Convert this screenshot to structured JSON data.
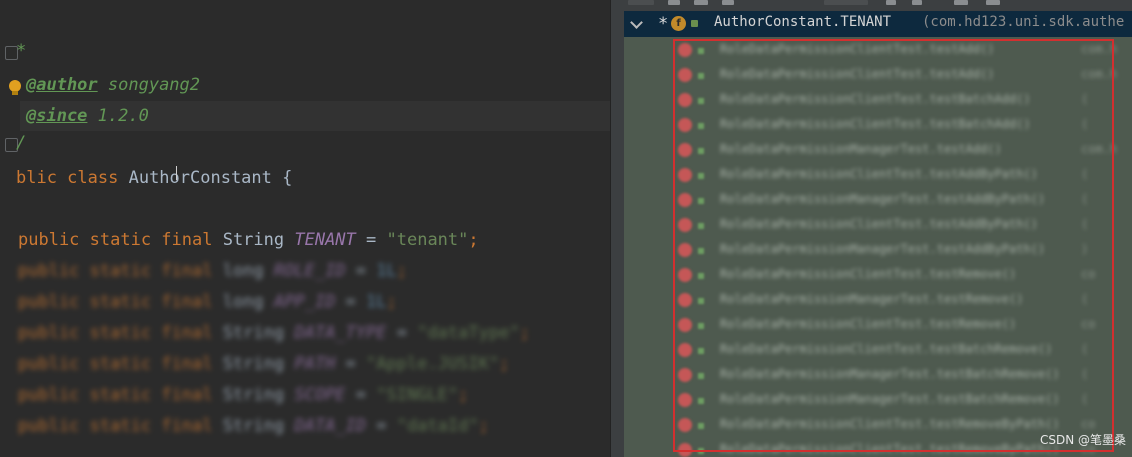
{
  "editor": {
    "doc_star": "*",
    "author_tag": "@author",
    "author_value": " songyang2",
    "since_tag": "@since",
    "since_value": " 1.2.0",
    "doc_end": "/",
    "class_kw": "blic class ",
    "class_name": "AuthorConstant",
    "class_brace": " {",
    "field_mods": "public static final ",
    "field_type": "String ",
    "field_name": "TENANT",
    "field_eq": " = ",
    "field_value": "\"tenant\"",
    "field_semi": ";"
  },
  "blurred_fields": [
    {
      "mods": "public static final ",
      "type": "long ",
      "name": "ROLE_ID",
      "value": "1L",
      "value_kind": "num"
    },
    {
      "mods": "public static final ",
      "type": "long ",
      "name": "APP_ID",
      "value": "1L",
      "value_kind": "num"
    },
    {
      "mods": "public static final ",
      "type": "String ",
      "name": "DATA_TYPE",
      "value": "\"dataType\"",
      "value_kind": "str"
    },
    {
      "mods": "public static final ",
      "type": "String ",
      "name": "PATH",
      "value": "\"Apple.JUSIK\"",
      "value_kind": "str"
    },
    {
      "mods": "public static final ",
      "type": "String ",
      "name": "SCOPE",
      "value": "\"SINGLE\"",
      "value_kind": "str"
    },
    {
      "mods": "public static final ",
      "type": "String ",
      "name": "DATA_ID",
      "value": "\"dataId\"",
      "value_kind": "str"
    }
  ],
  "usages_panel": {
    "star": "*",
    "field_badge": "f",
    "selected_title": "AuthorConstant.TENANT",
    "selected_package": "(com.hd123.uni.sdk.authe",
    "rows": [
      {
        "text": "RoleDataPermissionClientTest.testAdd()",
        "tail": "com.h"
      },
      {
        "text": "RoleDataPermissionClientTest.testAdd()",
        "tail": "com.h"
      },
      {
        "text": "RoleDataPermissionClientTest.testBatchAdd()",
        "tail": "("
      },
      {
        "text": "RoleDataPermissionClientTest.testBatchAdd()",
        "tail": "("
      },
      {
        "text": "RoleDataPermissionManagerTest.testAdd()",
        "tail": "com.h"
      },
      {
        "text": "RoleDataPermissionClientTest.testAddByPath()",
        "tail": "("
      },
      {
        "text": "RoleDataPermissionManagerTest.testAddByPath()",
        "tail": "("
      },
      {
        "text": "RoleDataPermissionClientTest.testAddByPath()",
        "tail": "("
      },
      {
        "text": "RoleDataPermissionManagerTest.testAddByPath()",
        "tail": ")"
      },
      {
        "text": "RoleDataPermissionClientTest.testRemove()",
        "tail": "co"
      },
      {
        "text": "RoleDataPermissionManagerTest.testRemove()",
        "tail": "("
      },
      {
        "text": "RoleDataPermissionClientTest.testRemove()",
        "tail": "co"
      },
      {
        "text": "RoleDataPermissionClientTest.testBatchRemove()",
        "tail": "("
      },
      {
        "text": "RoleDataPermissionManagerTest.testBatchRemove()",
        "tail": "("
      },
      {
        "text": "RoleDataPermissionManagerTest.testBatchRemove()",
        "tail": "("
      },
      {
        "text": "RoleDataPermissionClientTest.testRemoveByPath()",
        "tail": "co"
      },
      {
        "text": "RoleDataPermissionClientTest.testRemoveByPath()",
        "tail": "co"
      }
    ]
  },
  "watermark": "CSDN @笔墨桑"
}
